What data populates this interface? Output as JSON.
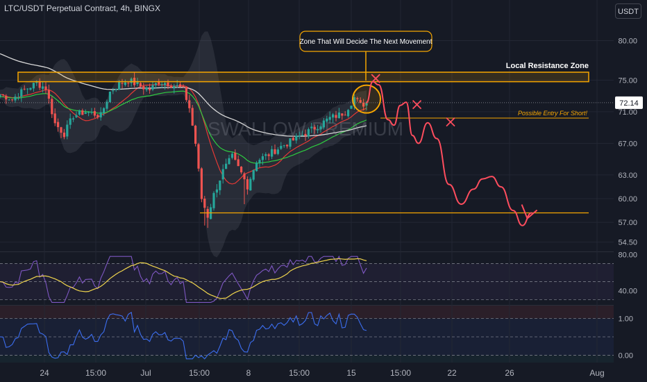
{
  "header": {
    "title": "LTC/USDT Perpetual Contract, 4h, BINGX",
    "currency_button": "USDT"
  },
  "colors": {
    "background": "#161a25",
    "up": "#26a69a",
    "down": "#ef5350",
    "annotation": "#f7a600",
    "forecast": "#ff4d5e",
    "rsi": "#7e57c2",
    "rsi_ma": "#f0d54d",
    "osc": "#3c6ef0",
    "bb_basis": "#e53935",
    "bb_fill": "#7a7f8c",
    "ma_green": "#2ecc40",
    "ma_white": "#d9d9d9"
  },
  "chart_data": [
    {
      "type": "candlestick",
      "panel": "price",
      "symbol": "LTC/USDT Perpetual Contract",
      "interval": "4h",
      "exchange": "BINGX",
      "ylim": [
        53.5,
        82.5
      ],
      "y_ticks": [
        "80.00",
        "75.00",
        "71.00",
        "67.00",
        "63.00",
        "60.00",
        "57.00",
        "54.50"
      ],
      "x_ticks": [
        "24",
        "15:00",
        "Jul",
        "15:00",
        "8",
        "15:00",
        "15",
        "15:00",
        "22",
        "26",
        "Aug"
      ],
      "last_price": "72.14",
      "watermark": "SWALLOW PREMIUM",
      "price_path": [
        [
          0,
          73.2
        ],
        [
          4,
          72.6
        ],
        [
          8,
          73.8
        ],
        [
          12,
          74.6
        ],
        [
          15,
          74.0
        ],
        [
          18,
          69.5
        ],
        [
          21,
          68.2
        ],
        [
          24,
          70.5
        ],
        [
          28,
          71.0
        ],
        [
          33,
          70.5
        ],
        [
          36,
          73.5
        ],
        [
          39,
          74.5
        ],
        [
          42,
          75.0
        ],
        [
          46,
          74.2
        ],
        [
          49,
          73.8
        ],
        [
          52,
          74.8
        ],
        [
          55,
          74.6
        ],
        [
          58,
          74.2
        ],
        [
          60,
          73.8
        ],
        [
          62,
          71.5
        ],
        [
          64,
          67.0
        ],
        [
          66,
          60.0
        ],
        [
          68,
          57.8
        ],
        [
          70,
          60.5
        ],
        [
          73,
          63.5
        ],
        [
          76,
          65.3
        ],
        [
          79,
          63.2
        ],
        [
          81,
          61.6
        ],
        [
          84,
          64.8
        ],
        [
          88,
          65.6
        ],
        [
          92,
          66.6
        ],
        [
          96,
          67.4
        ],
        [
          100,
          68.3
        ],
        [
          104,
          69.2
        ],
        [
          108,
          70.2
        ],
        [
          111,
          70.6
        ],
        [
          113,
          71.0
        ],
        [
          116,
          72.8
        ],
        [
          118,
          71.8
        ],
        [
          120,
          72.14
        ]
      ],
      "resistance_zone": {
        "label": "Local Resistance Zone",
        "low": 74.8,
        "high": 76.0
      },
      "callout": "Zone That Will Decide The Next Movement",
      "entry_level": {
        "label": "Possible Entry For Short!",
        "value": 70.2
      },
      "support_level": 58.2,
      "forecast_path": [
        [
          120,
          72.14
        ],
        [
          122,
          74.8
        ],
        [
          124,
          74.4
        ],
        [
          127,
          70.0
        ],
        [
          129,
          69.3
        ],
        [
          131,
          71.8
        ],
        [
          133,
          72.2
        ],
        [
          135,
          68.0
        ],
        [
          137,
          67.0
        ],
        [
          140,
          69.6
        ],
        [
          143,
          67.6
        ],
        [
          147,
          61.8
        ],
        [
          151,
          59.3
        ],
        [
          155,
          61.2
        ],
        [
          158,
          62.5
        ],
        [
          161,
          62.8
        ],
        [
          164,
          61.5
        ],
        [
          168,
          58.5
        ],
        [
          171,
          56.6
        ],
        [
          174,
          58.2
        ]
      ]
    },
    {
      "type": "line",
      "panel": "rsi",
      "ylim": [
        25,
        82
      ],
      "y_ticks": [
        "80.00",
        "40.00"
      ],
      "levels": [
        70,
        50,
        30
      ]
    },
    {
      "type": "line",
      "panel": "oscillator",
      "ylim": [
        -0.2,
        1.35
      ],
      "y_ticks": [
        "1.00",
        "0.00"
      ],
      "levels": [
        1.0,
        0.5,
        0.0
      ]
    }
  ]
}
